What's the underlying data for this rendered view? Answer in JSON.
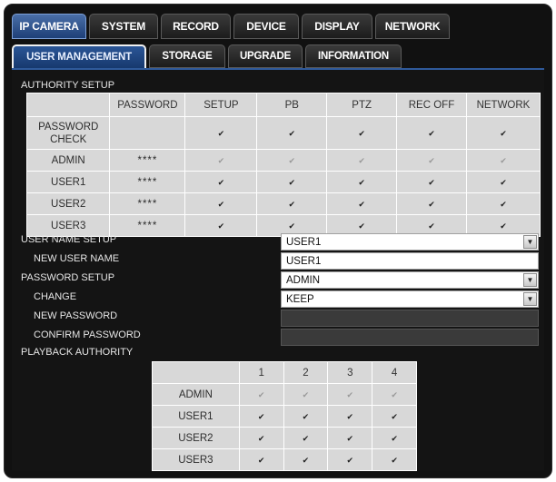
{
  "main_tabs": [
    "IP CAMERA",
    "SYSTEM",
    "RECORD",
    "DEVICE",
    "DISPLAY",
    "NETWORK"
  ],
  "sub_tabs": [
    "USER MANAGEMENT",
    "STORAGE",
    "UPGRADE",
    "INFORMATION"
  ],
  "authority": {
    "title": "AUTHORITY SETUP",
    "headers": [
      "",
      "PASSWORD",
      "SETUP",
      "PB",
      "PTZ",
      "REC OFF",
      "NETWORK"
    ],
    "rows": [
      {
        "name": "PASSWORD CHECK",
        "password": "",
        "checks": [
          true,
          true,
          true,
          true,
          true
        ],
        "disabled": false
      },
      {
        "name": "ADMIN",
        "password": "****",
        "checks": [
          true,
          true,
          true,
          true,
          true
        ],
        "disabled": true
      },
      {
        "name": "USER1",
        "password": "****",
        "checks": [
          true,
          true,
          true,
          true,
          true
        ],
        "disabled": false
      },
      {
        "name": "USER2",
        "password": "****",
        "checks": [
          true,
          true,
          true,
          true,
          true
        ],
        "disabled": false
      },
      {
        "name": "USER3",
        "password": "****",
        "checks": [
          true,
          true,
          true,
          true,
          true
        ],
        "disabled": false
      }
    ]
  },
  "user_name_setup": {
    "label": "USER NAME SETUP",
    "value": "USER1"
  },
  "new_user_name": {
    "label": "NEW USER NAME",
    "value": "USER1"
  },
  "password_setup": {
    "label": "PASSWORD SETUP",
    "value": "ADMIN"
  },
  "change": {
    "label": "CHANGE",
    "value": "KEEP"
  },
  "new_password": {
    "label": "NEW PASSWORD",
    "value": ""
  },
  "confirm_password": {
    "label": "CONFIRM PASSWORD",
    "value": ""
  },
  "playback": {
    "title": "PLAYBACK AUTHORITY",
    "headers": [
      "",
      "1",
      "2",
      "3",
      "4"
    ],
    "rows": [
      {
        "name": "ADMIN",
        "checks": [
          true,
          true,
          true,
          true
        ],
        "disabled": true
      },
      {
        "name": "USER1",
        "checks": [
          true,
          true,
          true,
          true
        ],
        "disabled": false
      },
      {
        "name": "USER2",
        "checks": [
          true,
          true,
          true,
          true
        ],
        "disabled": false
      },
      {
        "name": "USER3",
        "checks": [
          true,
          true,
          true,
          true
        ],
        "disabled": false
      }
    ]
  },
  "icons": {
    "check": "checkmark-icon",
    "dropdown": "triangle-down-icon"
  }
}
